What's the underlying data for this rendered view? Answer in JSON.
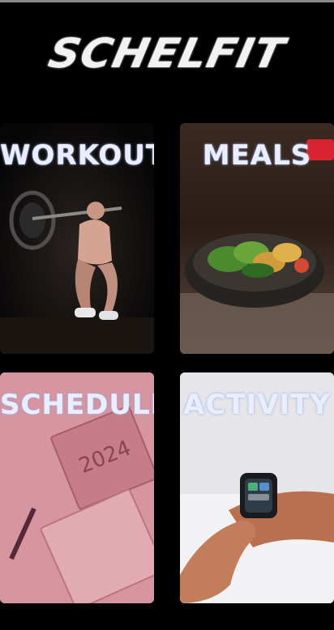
{
  "app": {
    "logo_text": "SCHELFIT"
  },
  "tiles": [
    {
      "label": "WORKOUT"
    },
    {
      "label": "MEALS"
    },
    {
      "label": "SCHEDULE"
    },
    {
      "label": "ACTIVITY"
    }
  ],
  "colors": {
    "background": "#000000",
    "label_text": "#e9eeff",
    "label_glow": "#8fa4e6",
    "meals_badge": "#d9232e"
  }
}
